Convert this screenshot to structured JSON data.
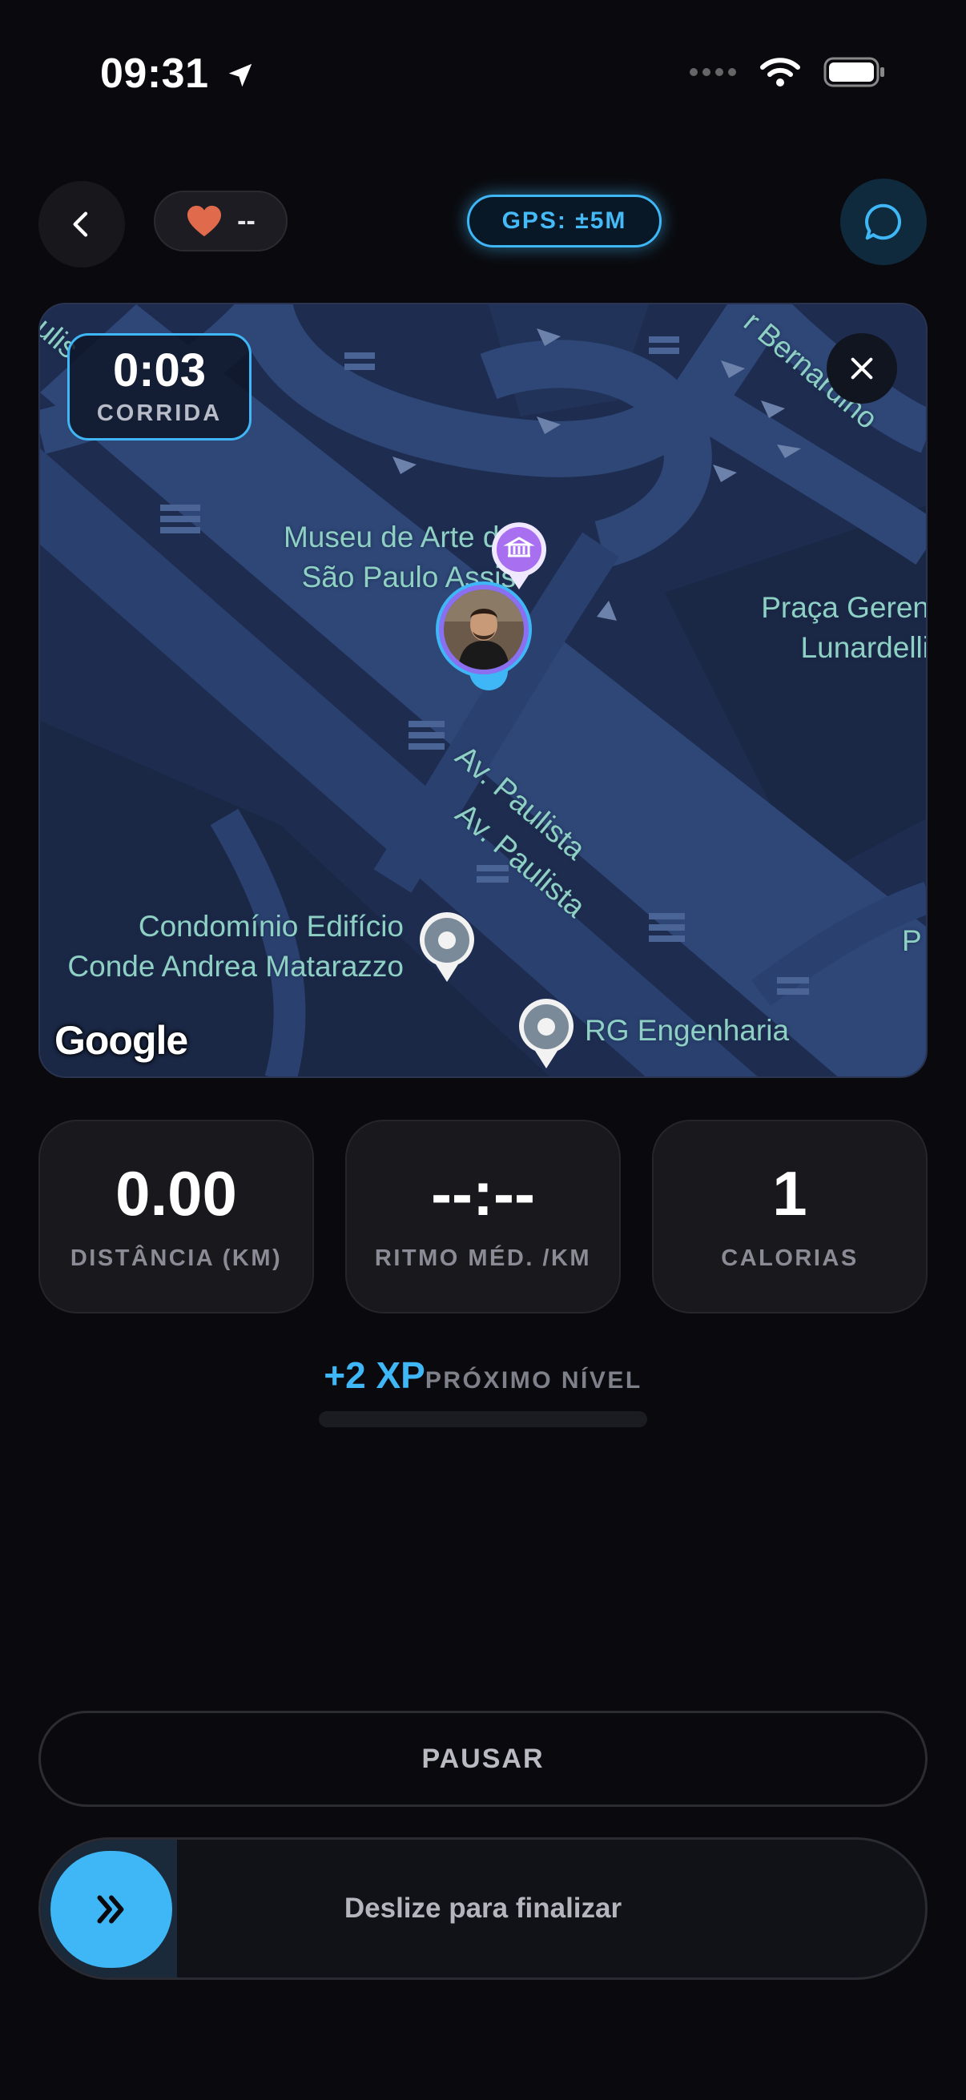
{
  "status_bar": {
    "time": "09:31"
  },
  "header": {
    "heart_rate": "--",
    "gps_label": "GPS: ±5M"
  },
  "map": {
    "timer": "0:03",
    "activity": "CORRIDA",
    "places": {
      "museum_line1": "Museu de Arte de",
      "museum_line2": "São Paulo Assis",
      "praca_line1": "Praça Geren",
      "praca_line2": "Lunardelli",
      "street1": "Av. Paulista",
      "street2": "Av. Paulista",
      "condo_line1": "Condomínio Edifício",
      "condo_line2": "Conde Andrea Matarazzo",
      "rg": "RG Engenharia",
      "bernardino": "r Bernardino",
      "corner_left": "aulis",
      "corner_right": "P"
    },
    "attribution": "Google"
  },
  "stats": [
    {
      "value": "0.00",
      "label": "DISTÂNCIA (KM)"
    },
    {
      "value": "--:--",
      "label": "RITMO MÉD. /KM"
    },
    {
      "value": "1",
      "label": "CALORIAS"
    }
  ],
  "xp": {
    "value": "+2 XP",
    "label": "PRÓXIMO NÍVEL",
    "progress": 0
  },
  "actions": {
    "pause": "PAUSAR",
    "slide_to_finish": "Deslize para finalizar"
  },
  "colors": {
    "accent": "#3fb6f5",
    "heart": "#e06a4c",
    "museum_pin": "#a86ff0",
    "map_bg": "#1d2c4f"
  }
}
